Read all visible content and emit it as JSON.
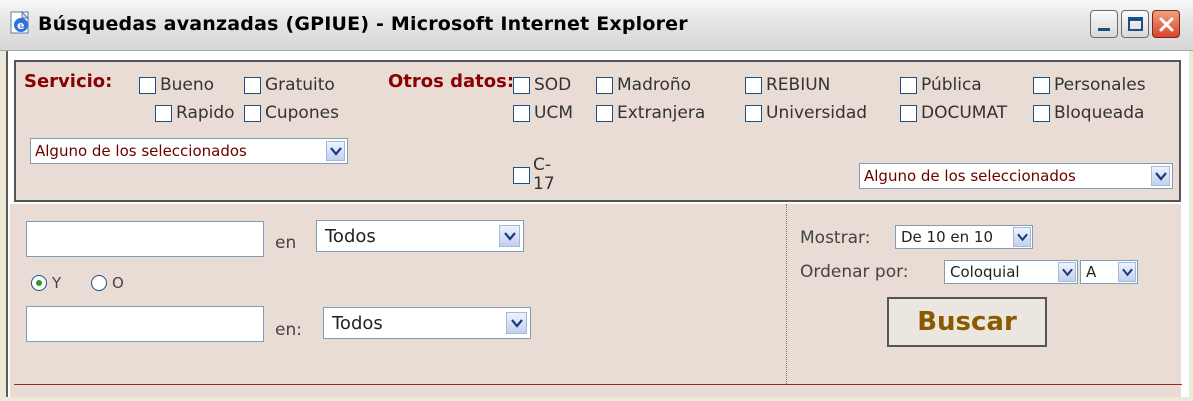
{
  "window": {
    "title": "Búsquedas avanzadas (GPIUE) - Microsoft Internet Explorer"
  },
  "filters": {
    "servicio_label": "Servicio:",
    "servicio_options": [
      "Bueno",
      "Gratuito",
      "Rapido",
      "Cupones"
    ],
    "servicio_select": "Alguno de los seleccionados",
    "otros_label": "Otros datos:",
    "otros_row1": [
      "SOD",
      "Madroño",
      "REBIUN",
      "Pública",
      "Personales"
    ],
    "otros_row2": [
      "UCM",
      "Extranjera",
      "Universidad",
      "DOCUMAT",
      "Bloqueada"
    ],
    "otros_c17_line1": "C-",
    "otros_c17_line2": "17",
    "otros_select": "Alguno de los seleccionados"
  },
  "search": {
    "en_label_1": "en",
    "field_select_1": "Todos",
    "radio_y": "Y",
    "radio_o": "O",
    "en_label_2": "en:",
    "field_select_2": "Todos"
  },
  "options": {
    "mostrar_label": "Mostrar:",
    "mostrar_value": "De 10 en 10",
    "ordenar_label": "Ordenar por:",
    "ordenar_value": "Coloquial",
    "order_dir_value": "A",
    "buscar_label": "Buscar"
  },
  "icons": {
    "app": "ie-page-icon",
    "minimize": "minimize-icon",
    "maximize": "maximize-icon",
    "close": "close-icon",
    "dropdown": "chevron-down-icon"
  }
}
